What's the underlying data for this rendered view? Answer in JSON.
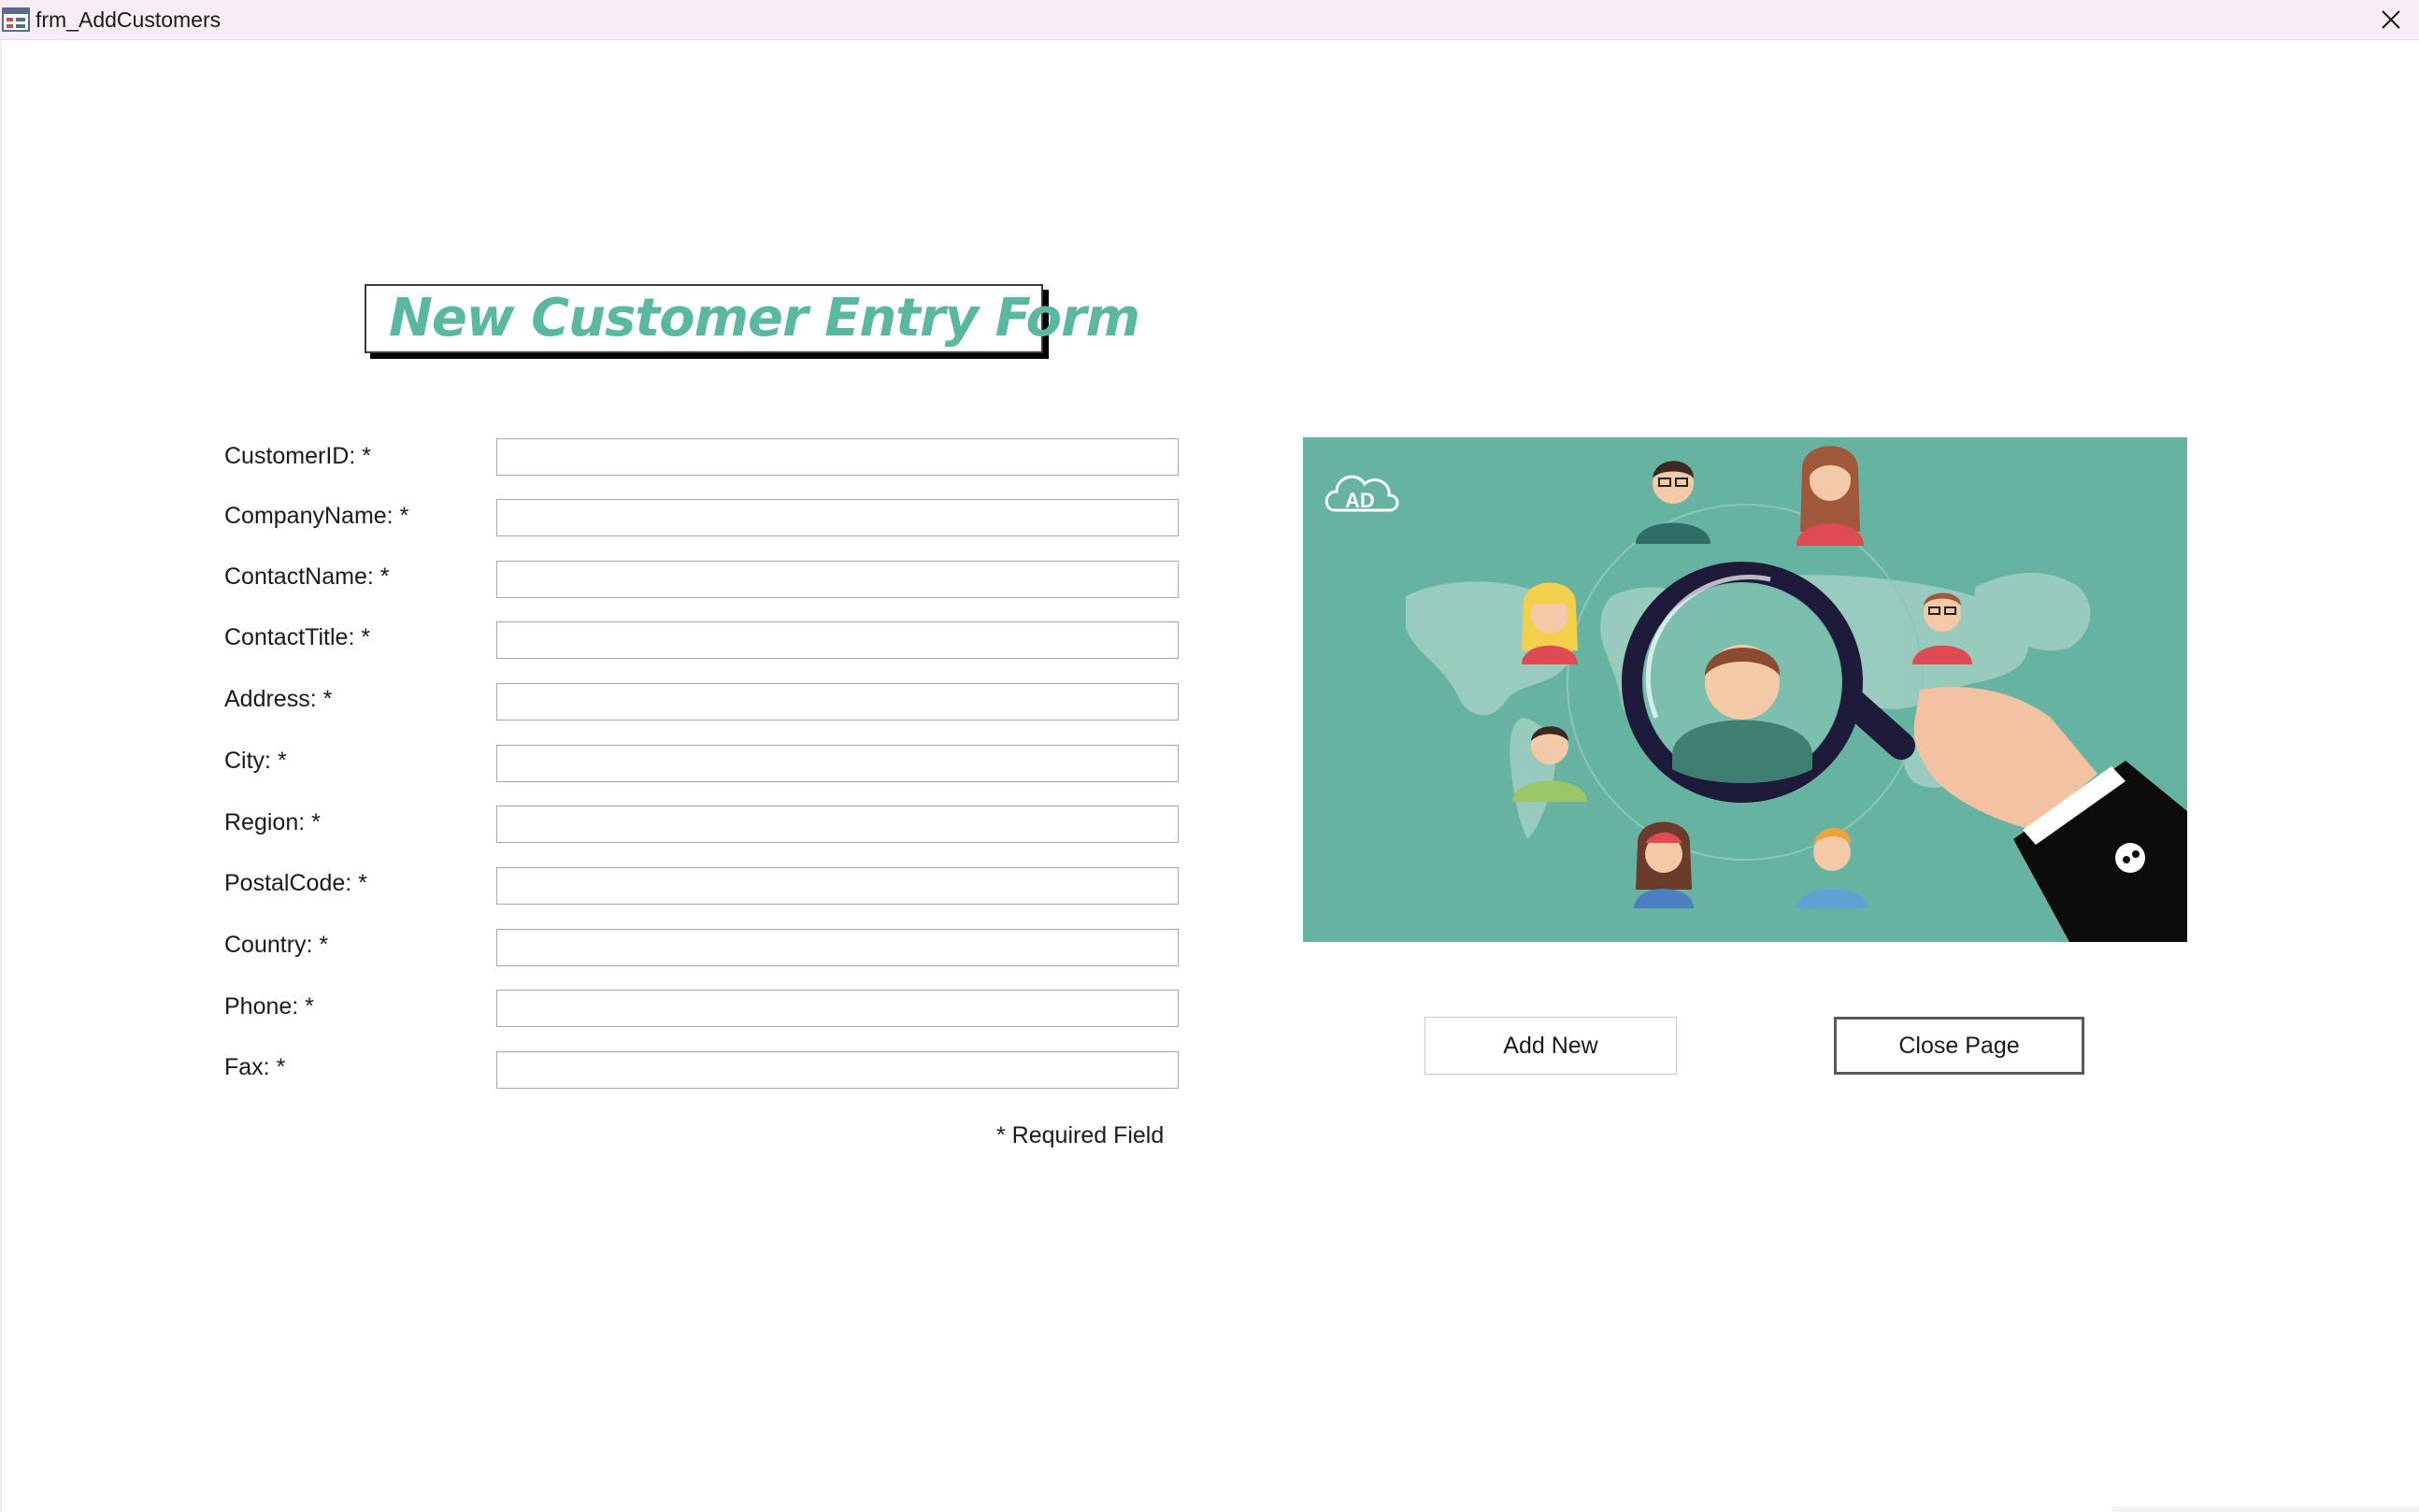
{
  "window": {
    "title": "frm_AddCustomers",
    "icon": "form-icon"
  },
  "form": {
    "title": "New Customer Entry Form",
    "fields": [
      {
        "label": "CustomerID: *",
        "value": ""
      },
      {
        "label": "CompanyName: *",
        "value": ""
      },
      {
        "label": "ContactName: *",
        "value": ""
      },
      {
        "label": "ContactTitle: *",
        "value": ""
      },
      {
        "label": "Address: *",
        "value": ""
      },
      {
        "label": "City: *",
        "value": ""
      },
      {
        "label": "Region: *",
        "value": ""
      },
      {
        "label": "PostalCode: *",
        "value": ""
      },
      {
        "label": "Country: *",
        "value": ""
      },
      {
        "label": "Phone: *",
        "value": ""
      },
      {
        "label": "Fax: *",
        "value": ""
      }
    ],
    "required_note": "* Required Field"
  },
  "illustration": {
    "logo_text": "AD",
    "background_color": "#67b3a1"
  },
  "buttons": {
    "add_new": "Add New",
    "close_page": "Close Page"
  },
  "colors": {
    "title_accent": "#5bb8a0",
    "titlebar": "#f6eef4"
  }
}
